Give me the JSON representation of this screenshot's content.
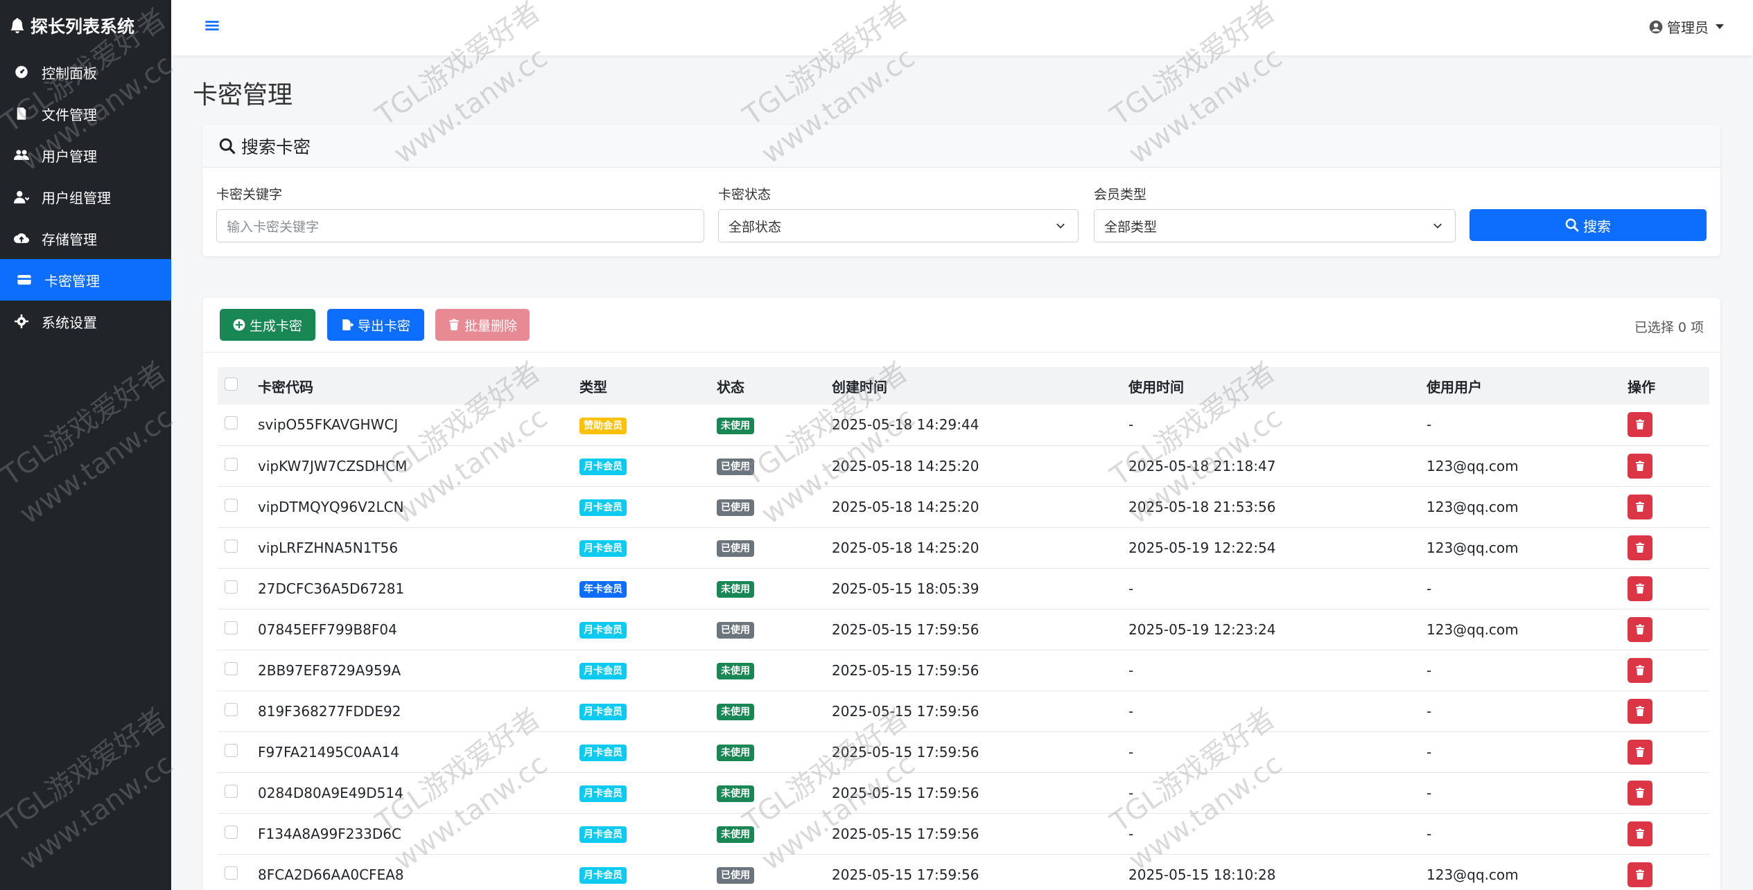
{
  "brand": {
    "title": "探长列表系统"
  },
  "sidebar": {
    "items": [
      {
        "label": "控制面板",
        "icon": "dashboard-icon"
      },
      {
        "label": "文件管理",
        "icon": "file-icon"
      },
      {
        "label": "用户管理",
        "icon": "users-icon"
      },
      {
        "label": "用户组管理",
        "icon": "user-group-icon"
      },
      {
        "label": "存储管理",
        "icon": "cloud-upload-icon"
      },
      {
        "label": "卡密管理",
        "icon": "card-icon",
        "active": true
      },
      {
        "label": "系统设置",
        "icon": "gear-icon"
      }
    ]
  },
  "topbar": {
    "user_label": "管理员"
  },
  "page": {
    "title": "卡密管理"
  },
  "search": {
    "header": "搜索卡密",
    "keyword_label": "卡密关键字",
    "keyword_placeholder": "输入卡密关键字",
    "status_label": "卡密状态",
    "status_value": "全部状态",
    "member_label": "会员类型",
    "member_value": "全部类型",
    "button_label": "搜索"
  },
  "toolbar": {
    "generate_label": "生成卡密",
    "export_label": "导出卡密",
    "batch_delete_label": "批量删除",
    "selected_text": "已选择 0 项"
  },
  "table": {
    "headers": [
      "卡密代码",
      "类型",
      "状态",
      "创建时间",
      "使用时间",
      "使用用户",
      "操作"
    ],
    "rows": [
      {
        "code": "svipO55FKAVGHWCJ",
        "type": "赞助会员",
        "type_color": "#ffc107",
        "status": "未使用",
        "status_color": "#198754",
        "created": "2025-05-18 14:29:44",
        "used_at": "-",
        "user": "-"
      },
      {
        "code": "vipKW7JW7CZSDHCM",
        "type": "月卡会员",
        "type_color": "#0dcaf0",
        "status": "已使用",
        "status_color": "#6c757d",
        "created": "2025-05-18 14:25:20",
        "used_at": "2025-05-18 21:18:47",
        "user": "123@qq.com"
      },
      {
        "code": "vipDTMQYQ96V2LCN",
        "type": "月卡会员",
        "type_color": "#0dcaf0",
        "status": "已使用",
        "status_color": "#6c757d",
        "created": "2025-05-18 14:25:20",
        "used_at": "2025-05-18 21:53:56",
        "user": "123@qq.com"
      },
      {
        "code": "vipLRFZHNA5N1T56",
        "type": "月卡会员",
        "type_color": "#0dcaf0",
        "status": "已使用",
        "status_color": "#6c757d",
        "created": "2025-05-18 14:25:20",
        "used_at": "2025-05-19 12:22:54",
        "user": "123@qq.com"
      },
      {
        "code": "27DCFC36A5D67281",
        "type": "年卡会员",
        "type_color": "#0d6efd",
        "status": "未使用",
        "status_color": "#198754",
        "created": "2025-05-15 18:05:39",
        "used_at": "-",
        "user": "-"
      },
      {
        "code": "07845EFF799B8F04",
        "type": "月卡会员",
        "type_color": "#0dcaf0",
        "status": "已使用",
        "status_color": "#6c757d",
        "created": "2025-05-15 17:59:56",
        "used_at": "2025-05-19 12:23:24",
        "user": "123@qq.com"
      },
      {
        "code": "2BB97EF8729A959A",
        "type": "月卡会员",
        "type_color": "#0dcaf0",
        "status": "未使用",
        "status_color": "#198754",
        "created": "2025-05-15 17:59:56",
        "used_at": "-",
        "user": "-"
      },
      {
        "code": "819F368277FDDE92",
        "type": "月卡会员",
        "type_color": "#0dcaf0",
        "status": "未使用",
        "status_color": "#198754",
        "created": "2025-05-15 17:59:56",
        "used_at": "-",
        "user": "-"
      },
      {
        "code": "F97FA21495C0AA14",
        "type": "月卡会员",
        "type_color": "#0dcaf0",
        "status": "未使用",
        "status_color": "#198754",
        "created": "2025-05-15 17:59:56",
        "used_at": "-",
        "user": "-"
      },
      {
        "code": "0284D80A9E49D514",
        "type": "月卡会员",
        "type_color": "#0dcaf0",
        "status": "未使用",
        "status_color": "#198754",
        "created": "2025-05-15 17:59:56",
        "used_at": "-",
        "user": "-"
      },
      {
        "code": "F134A8A99F233D6C",
        "type": "月卡会员",
        "type_color": "#0dcaf0",
        "status": "未使用",
        "status_color": "#198754",
        "created": "2025-05-15 17:59:56",
        "used_at": "-",
        "user": "-"
      },
      {
        "code": "8FCA2D66AA0CFEA8",
        "type": "月卡会员",
        "type_color": "#0dcaf0",
        "status": "已使用",
        "status_color": "#6c757d",
        "created": "2025-05-15 17:59:56",
        "used_at": "2025-05-15 18:10:28",
        "user": "123@qq.com"
      }
    ]
  },
  "watermark": {
    "line1": "TGL游戏爱好者",
    "line2": "www.tanw.cc"
  },
  "colors": {
    "sidebar_bg": "#212529",
    "primary": "#0d6efd",
    "success": "#198754",
    "danger": "#dc3545"
  }
}
